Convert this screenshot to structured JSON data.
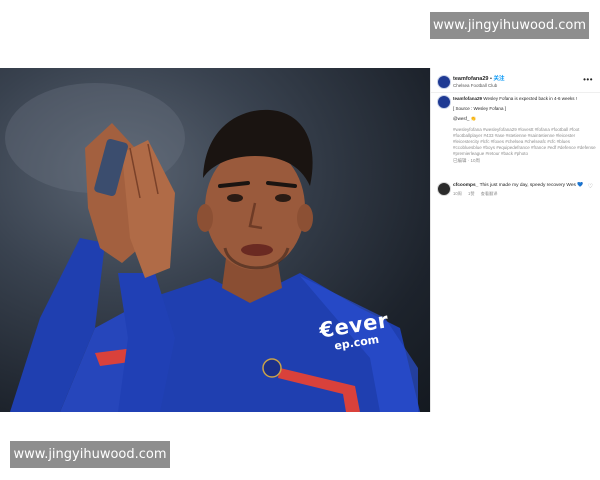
{
  "watermark": {
    "text": "www.jingyihuwood.com"
  },
  "photo": {
    "sponsor_text": "€ever",
    "sponsor_subtext": "ep.com",
    "colors": {
      "kit": "#1f3fb0",
      "kit_trim": "#d9413b",
      "skin": "#9a5a3c",
      "hair": "#1a1411",
      "bg": "#2a313c"
    }
  },
  "post": {
    "username": "teamfofana29",
    "dot": "•",
    "follow_label": "关注",
    "location": "Chelsea Football Club",
    "more_icon": "more-horizontal-icon",
    "caption": {
      "username": "teamfofana29",
      "text": "Wesley Fofana is expected back in 4-6 weeks !",
      "source": "[ Source : Wesley Fofana ]",
      "mention": "@wesf_ 👏",
      "hashtags": "#wesleyfofana #wesleyfofana29 #lovestt #fofana #football #foot #footballplayer #433 #ase #stetienne #saintetienne #leicester #leicestercity #lcfc #foxes #chelsea #chelseafc #cfc #blues #ccobluesblue #boys #equipedefrance #france #edf #defence #defense #premierleague #retour #back #photo",
      "meta": "已编辑 · 10周"
    },
    "comment": {
      "username": "cfcoomps_",
      "text": "This just made my day, speedy recovery Wes 💙",
      "meta": [
        "10周",
        "1赞",
        "查看翻译"
      ],
      "like_icon": "heart-outline-icon"
    }
  }
}
